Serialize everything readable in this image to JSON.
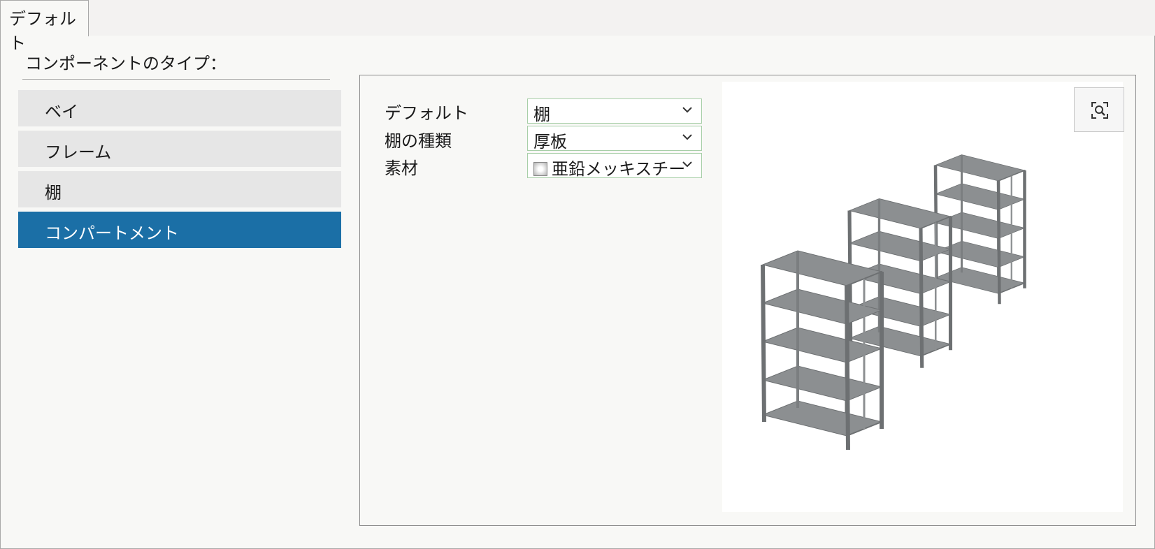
{
  "tab": {
    "label": "デフォルト"
  },
  "component_types": {
    "label": "コンポーネントのタイプ：",
    "items": [
      {
        "label": "ベイ",
        "selected": false
      },
      {
        "label": "フレーム",
        "selected": false
      },
      {
        "label": "棚",
        "selected": false
      },
      {
        "label": "コンパートメント",
        "selected": true
      }
    ]
  },
  "properties": [
    {
      "label": "デフォルト",
      "value": "棚"
    },
    {
      "label": "棚の種類",
      "value": "厚板"
    },
    {
      "label": "素材",
      "value": "亜鉛メッキスチー",
      "swatch": "galvanized-steel"
    }
  ],
  "preview": {
    "zoom_icon": "zoom-fit-icon",
    "subject": "3d-shelving-units-icon"
  },
  "colors": {
    "selected_bg": "#1b6fa6",
    "item_bg": "#e6e6e6",
    "dropdown_border": "#a8cfa8",
    "shelf_gray": "#8c8f91"
  }
}
